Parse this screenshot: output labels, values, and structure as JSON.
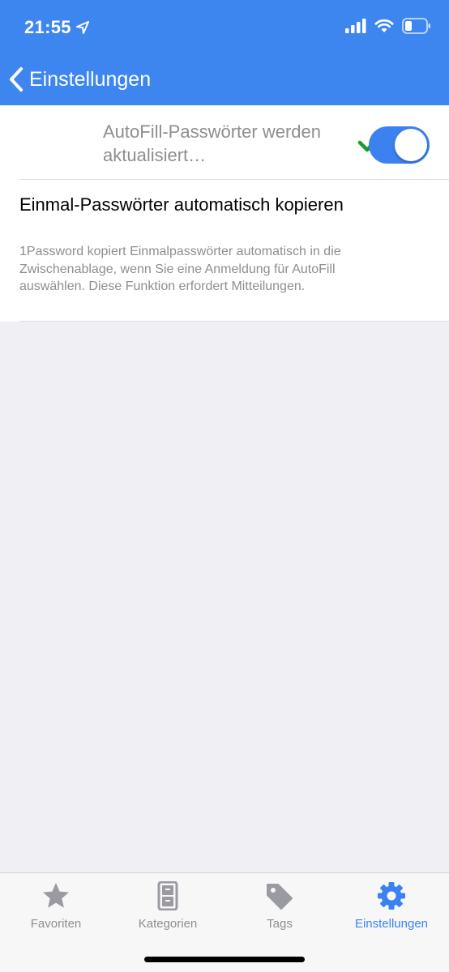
{
  "status_bar": {
    "time": "21:55",
    "icons": [
      "location-arrow-icon",
      "cellular-signal-icon",
      "wifi-icon",
      "battery-icon"
    ]
  },
  "nav": {
    "back_label": "Einstellungen"
  },
  "autofill_status": {
    "text": "AutoFill-Passwörter werden aktualisiert…",
    "icon": "checkmark-icon",
    "icon_color": "#1a9a2a"
  },
  "otp_setting": {
    "title": "Einmal-Passwörter automatisch kopieren",
    "description": "1Password kopiert Einmalpasswörter automatisch in die Zwischenablage, wenn Sie eine Anmeldung für AutoFill auswählen. Diese Funktion erfordert Mitteilungen.",
    "enabled": true
  },
  "tab_bar": {
    "tabs": [
      {
        "label": "Favoriten",
        "icon": "star-icon",
        "active": false
      },
      {
        "label": "Kategorien",
        "icon": "cabinet-icon",
        "active": false
      },
      {
        "label": "Tags",
        "icon": "tag-icon",
        "active": false
      },
      {
        "label": "Einstellungen",
        "icon": "gear-icon",
        "active": true
      }
    ]
  },
  "colors": {
    "accent": "#3b82f0",
    "header_bg": "#3d86f0",
    "inactive": "#8e8e93",
    "background": "#efeff4"
  }
}
